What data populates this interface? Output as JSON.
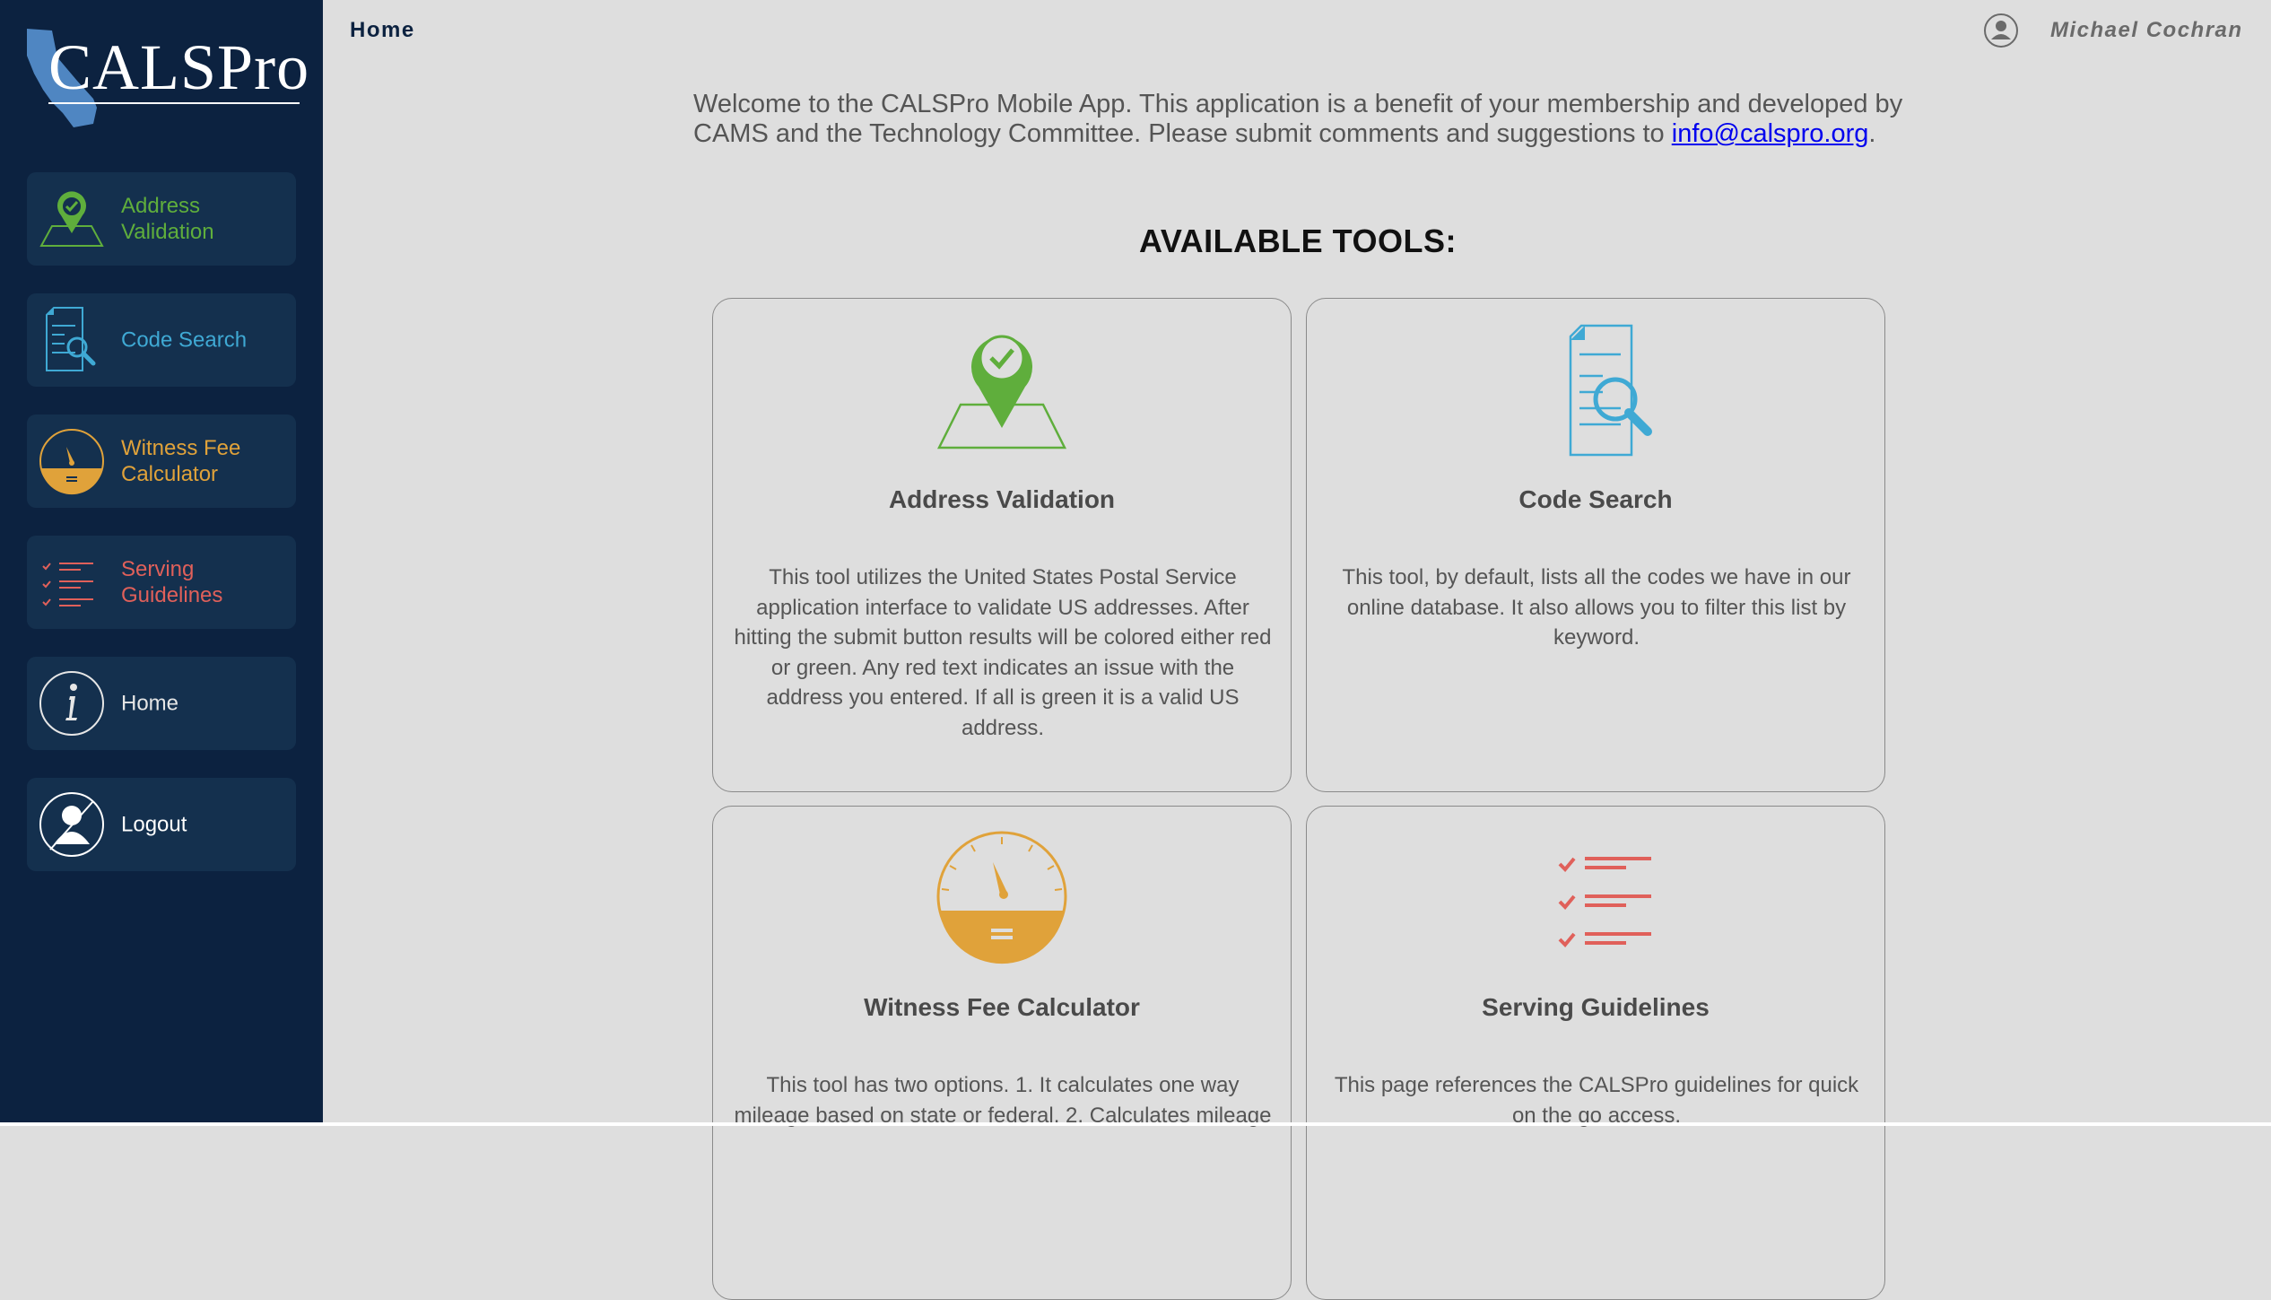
{
  "logo": {
    "text": "CALSPro"
  },
  "header": {
    "title": "Home",
    "user_name": "Michael Cochran"
  },
  "sidebar": {
    "items": [
      {
        "label": "Address Validation",
        "color": "#5fae3c",
        "icon": "map-pin-check-icon"
      },
      {
        "label": "Code Search",
        "color": "#3fa9d4",
        "icon": "document-search-icon"
      },
      {
        "label": "Witness Fee Calculator",
        "color": "#e0a23a",
        "icon": "gauge-icon"
      },
      {
        "label": "Serving Guidelines",
        "color": "#e0605a",
        "icon": "checklist-icon"
      },
      {
        "label": "Home",
        "color": "#e6e6e6",
        "icon": "info-icon"
      },
      {
        "label": "Logout",
        "color": "#ffffff",
        "icon": "user-logout-icon"
      }
    ]
  },
  "welcome": {
    "text": "Welcome to the CALSPro Mobile App. This application is a benefit of your membership and developed by CAMS and the Technology Committee. Please submit comments and suggestions to ",
    "email": "info@calspro.org",
    "trailing": "."
  },
  "tools": {
    "heading": "AVAILABLE TOOLS:",
    "cards": [
      {
        "title": "Address Validation",
        "description": "This tool utilizes the United States Postal Service application interface to validate US addresses. After hitting the submit button results will be colored either red or green. Any red text indicates an issue with the address you entered. If all is green it is a valid US address.",
        "icon": "map-pin-check-icon"
      },
      {
        "title": "Code Search",
        "description": "This tool, by default, lists all the codes we have in our online database. It also allows you to filter this list by keyword.",
        "icon": "document-search-icon"
      },
      {
        "title": "Witness Fee Calculator",
        "description": "This tool has two options. 1. It calculates one way mileage based on state or federal. 2. Calculates mileage",
        "icon": "gauge-icon"
      },
      {
        "title": "Serving Guidelines",
        "description": "This page references the CALSPro guidelines for quick on the go access.",
        "icon": "checklist-icon"
      }
    ]
  }
}
